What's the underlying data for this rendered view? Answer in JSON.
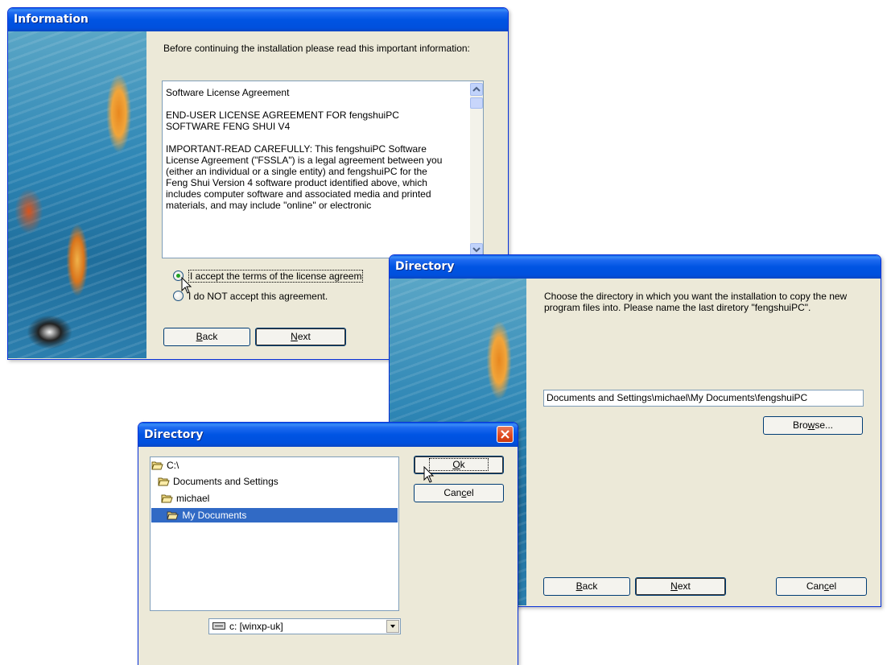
{
  "info_dialog": {
    "title": "Information",
    "intro": "Before continuing the installation please read this important information:",
    "license_paragraphs": [
      "Software License Agreement",
      "END-USER LICENSE AGREEMENT FOR fengshuiPC SOFTWARE FENG SHUI V4",
      "IMPORTANT-READ CAREFULLY: This fengshuiPC Software License Agreement (\"FSSLA\") is a legal agreement between you (either an individual or a single entity) and fengshuiPC for the Feng Shui Version 4 software product identified above, which includes computer software and associated media and printed materials, and may include \"online\" or electronic"
    ],
    "accept_label": "I accept the terms of the license agreem",
    "decline_label": "I do NOT accept this agreement.",
    "accept_selected": true,
    "back_label": "Back",
    "next_label": "Next"
  },
  "dir_wizard": {
    "title": "Directory",
    "instruction": "Choose the directory in which you want the installation to copy the new program files into. Please name the last diretory \"fengshuiPC\".",
    "path_value": "Documents and Settings\\michael\\My Documents\\fengshuiPC",
    "browse_label": "Browse...",
    "back_label": "Back",
    "next_label": "Next",
    "cancel_label": "Cancel"
  },
  "dir_picker": {
    "title": "Directory",
    "tree": [
      "C:\\",
      "Documents and Settings",
      "michael",
      "My Documents"
    ],
    "selected_index": 3,
    "ok_label": "Ok",
    "cancel_label": "Cancel",
    "drive_value": "c: [winxp-uk]",
    "colors": {
      "selection": "#316ac5",
      "title_bar": "#0054e3",
      "close_button": "#e0481d"
    }
  },
  "icons": [
    "folder-icon",
    "open-folder-icon",
    "drive-icon",
    "close-icon",
    "scroll-up-icon",
    "scroll-down-icon",
    "mouse-cursor-icon"
  ]
}
